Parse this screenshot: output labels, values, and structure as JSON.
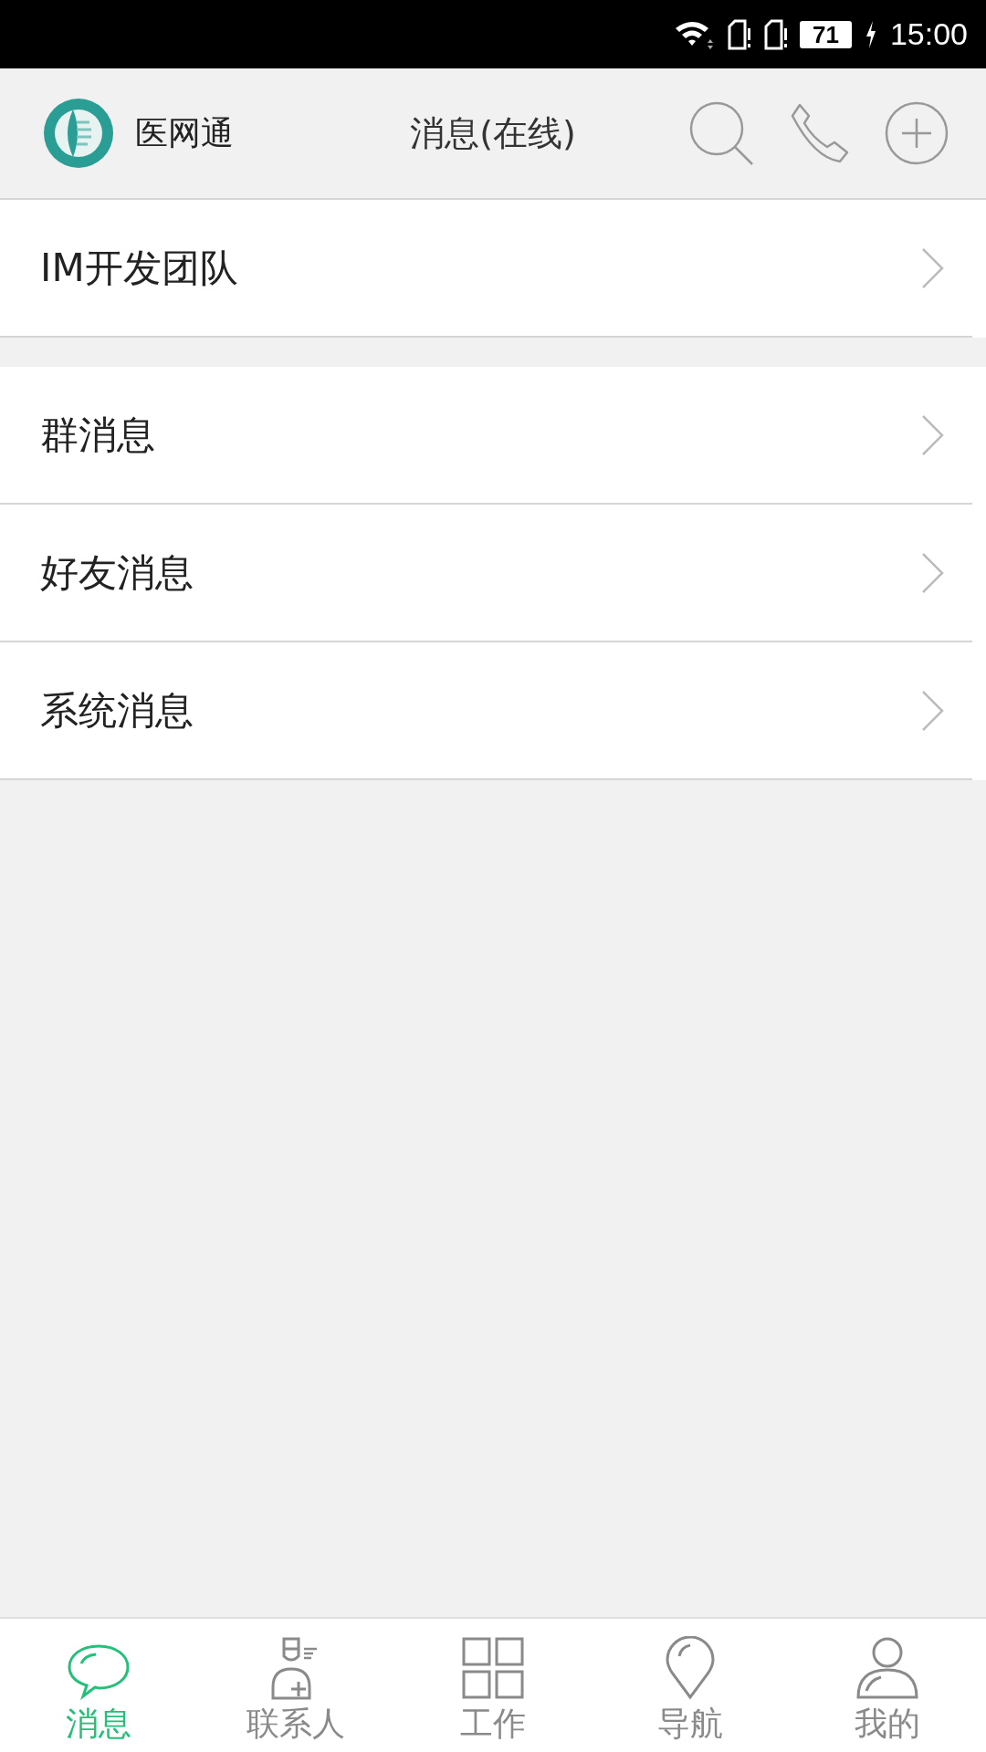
{
  "status_bar": {
    "battery": "71",
    "time": "15:00"
  },
  "header": {
    "app_name": "医网通",
    "title": "消息(在线)"
  },
  "sections": [
    {
      "items": [
        {
          "label": "IM开发团队"
        }
      ]
    },
    {
      "items": [
        {
          "label": "群消息"
        },
        {
          "label": "好友消息"
        },
        {
          "label": "系统消息"
        }
      ]
    }
  ],
  "tabs": [
    {
      "label": "消息",
      "kind": "chat",
      "selected": true
    },
    {
      "label": "联系人",
      "kind": "contact",
      "selected": false
    },
    {
      "label": "工作",
      "kind": "grid",
      "selected": false
    },
    {
      "label": "导航",
      "kind": "pin",
      "selected": false
    },
    {
      "label": "我的",
      "kind": "person",
      "selected": false
    }
  ]
}
